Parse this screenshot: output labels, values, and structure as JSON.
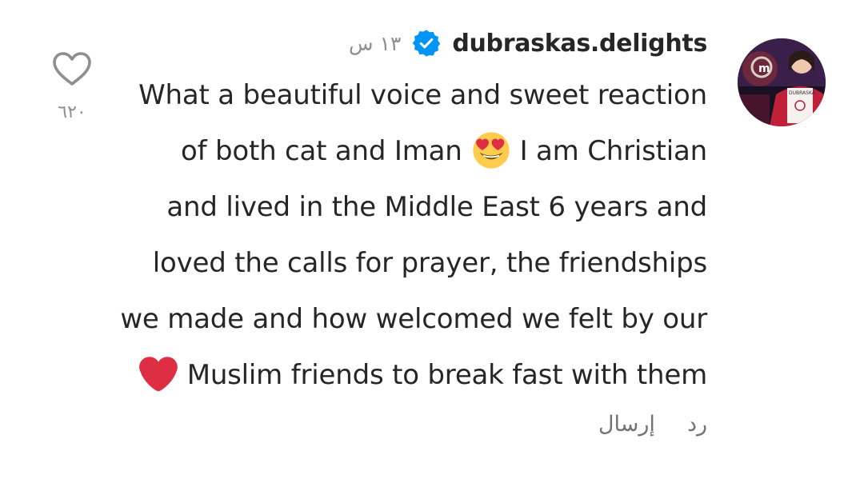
{
  "comment": {
    "username": "dubraskas.delights",
    "time": "١٣ س",
    "verified": true,
    "lines": [
      "What a beautiful voice and sweet reaction",
      "of both cat and Iman",
      "I am Christian",
      "and lived in the Middle East 6 years and",
      "loved the calls for prayer, the friendships",
      "we made and how welcomed we felt by our",
      "Muslim friends to break fast with them"
    ],
    "emojis": [
      "heart-eyes-emoji",
      "red-heart-emoji"
    ]
  },
  "avatar": {
    "badge_text": "DUBRASKA"
  },
  "actions": {
    "reply_label": "رد",
    "send_label": "إرسال"
  },
  "like": {
    "count": "٦٢٠"
  },
  "colors": {
    "text": "#262626",
    "secondary": "#8e8e8e",
    "verified": "#0095f6",
    "heart_red": "#dd2e44",
    "emoji_yellow": "#ffcc4d"
  }
}
